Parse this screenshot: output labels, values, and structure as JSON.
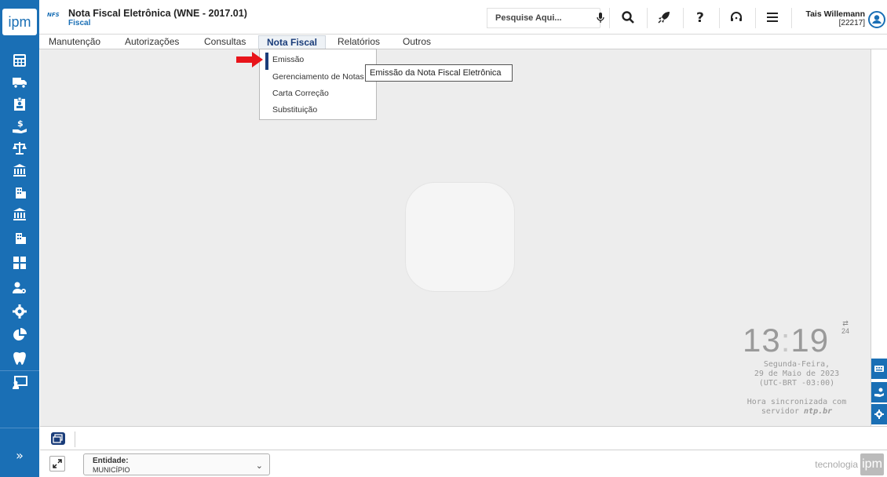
{
  "sidebar": {
    "logo": "ipm",
    "expand_label": "»",
    "icons": [
      "calculator-icon",
      "truck-icon",
      "badge-icon",
      "money-hand-icon",
      "scale-icon",
      "bank-icon",
      "buildings-icon",
      "bank-2-icon",
      "buildings-2-icon",
      "spreadsheet-icon",
      "user-gear-icon",
      "gear-icon",
      "pie-chart-icon",
      "tooth-icon",
      "presentation-icon"
    ]
  },
  "header": {
    "badge": "NFS",
    "title": "Nota Fiscal Eletrônica (WNE - 2017.01)",
    "subtitle": "Fiscal",
    "search_placeholder": "Pesquise Aqui...",
    "user_name": "Tais Willemann",
    "user_id": "[22217]"
  },
  "menu": {
    "items": [
      {
        "label": "Manutenção"
      },
      {
        "label": "Autorizações"
      },
      {
        "label": "Consultas"
      },
      {
        "label": "Nota Fiscal"
      },
      {
        "label": "Relatórios"
      },
      {
        "label": "Outros"
      }
    ],
    "active": "Nota Fiscal"
  },
  "dropdown": {
    "items": [
      {
        "label": "Emissão"
      },
      {
        "label": "Gerenciamento de Notas"
      },
      {
        "label": "Carta Correção"
      },
      {
        "label": "Substituição"
      }
    ],
    "tooltip": "Emissão da Nota Fiscal Eletrônica"
  },
  "clock": {
    "hours": "13",
    "separator": ":",
    "minutes": "19",
    "format_top": "⇄",
    "format": "24",
    "weekday": "Segunda-Feira,",
    "date": "29 de Maio de 2023",
    "timezone": "(UTC-BRT -03:00)",
    "sync_line1": "Hora sincronizada com",
    "sync_prefix": "servidor",
    "sync_server": "ntp.br"
  },
  "footer": {
    "entity_label": "Entidade:",
    "entity_value": "MUNICÍPIO",
    "brand_text": "tecnologia",
    "brand_logo": "ipm"
  },
  "colors": {
    "sidebar": "#1a6fb5",
    "accent": "#1a3d7a",
    "arrow": "#e8141a"
  }
}
